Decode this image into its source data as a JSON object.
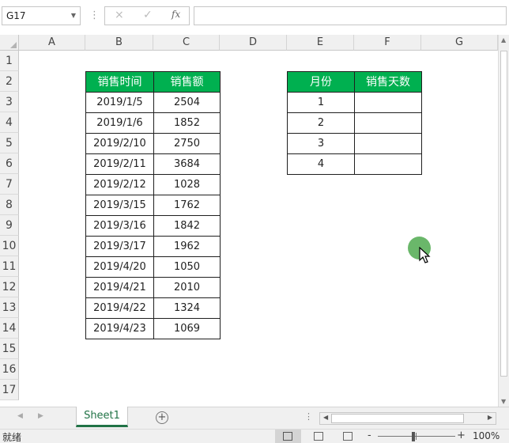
{
  "formula_bar": {
    "name_box": "G17",
    "cancel_icon": "×",
    "enter_icon": "✓",
    "fx_label": "fx",
    "formula": ""
  },
  "columns": [
    "A",
    "B",
    "C",
    "D",
    "E",
    "F",
    "G"
  ],
  "rows": [
    "1",
    "2",
    "3",
    "4",
    "5",
    "6",
    "7",
    "8",
    "9",
    "10",
    "11",
    "12",
    "13",
    "14",
    "15",
    "16",
    "17"
  ],
  "sales_table": {
    "headers": [
      "销售时间",
      "销售额"
    ],
    "rows": [
      [
        "2019/1/5",
        "2504"
      ],
      [
        "2019/1/6",
        "1852"
      ],
      [
        "2019/2/10",
        "2750"
      ],
      [
        "2019/2/11",
        "3684"
      ],
      [
        "2019/2/12",
        "1028"
      ],
      [
        "2019/3/15",
        "1762"
      ],
      [
        "2019/3/16",
        "1842"
      ],
      [
        "2019/3/17",
        "1962"
      ],
      [
        "2019/4/20",
        "1050"
      ],
      [
        "2019/4/21",
        "2010"
      ],
      [
        "2019/4/22",
        "1324"
      ],
      [
        "2019/4/23",
        "1069"
      ]
    ]
  },
  "month_table": {
    "headers": [
      "月份",
      "销售天数"
    ],
    "rows": [
      [
        "1",
        ""
      ],
      [
        "2",
        ""
      ],
      [
        "3",
        ""
      ],
      [
        "4",
        ""
      ]
    ]
  },
  "sheet_tabs": [
    "Sheet1"
  ],
  "status": {
    "text": "就绪",
    "zoom_minus": "-",
    "zoom_plus": "+",
    "zoom": "100%",
    "zoom_level_percent": 100
  },
  "colors": {
    "header_fill": "#00b050",
    "header_text": "#ffffff",
    "active_tab": "#217346"
  },
  "icons": [
    "dropdown-arrow-icon",
    "cancel-icon",
    "enter-icon",
    "fx-icon",
    "add-sheet-icon",
    "normal-view-icon",
    "page-layout-icon",
    "page-break-icon",
    "mouse-cursor-icon"
  ]
}
